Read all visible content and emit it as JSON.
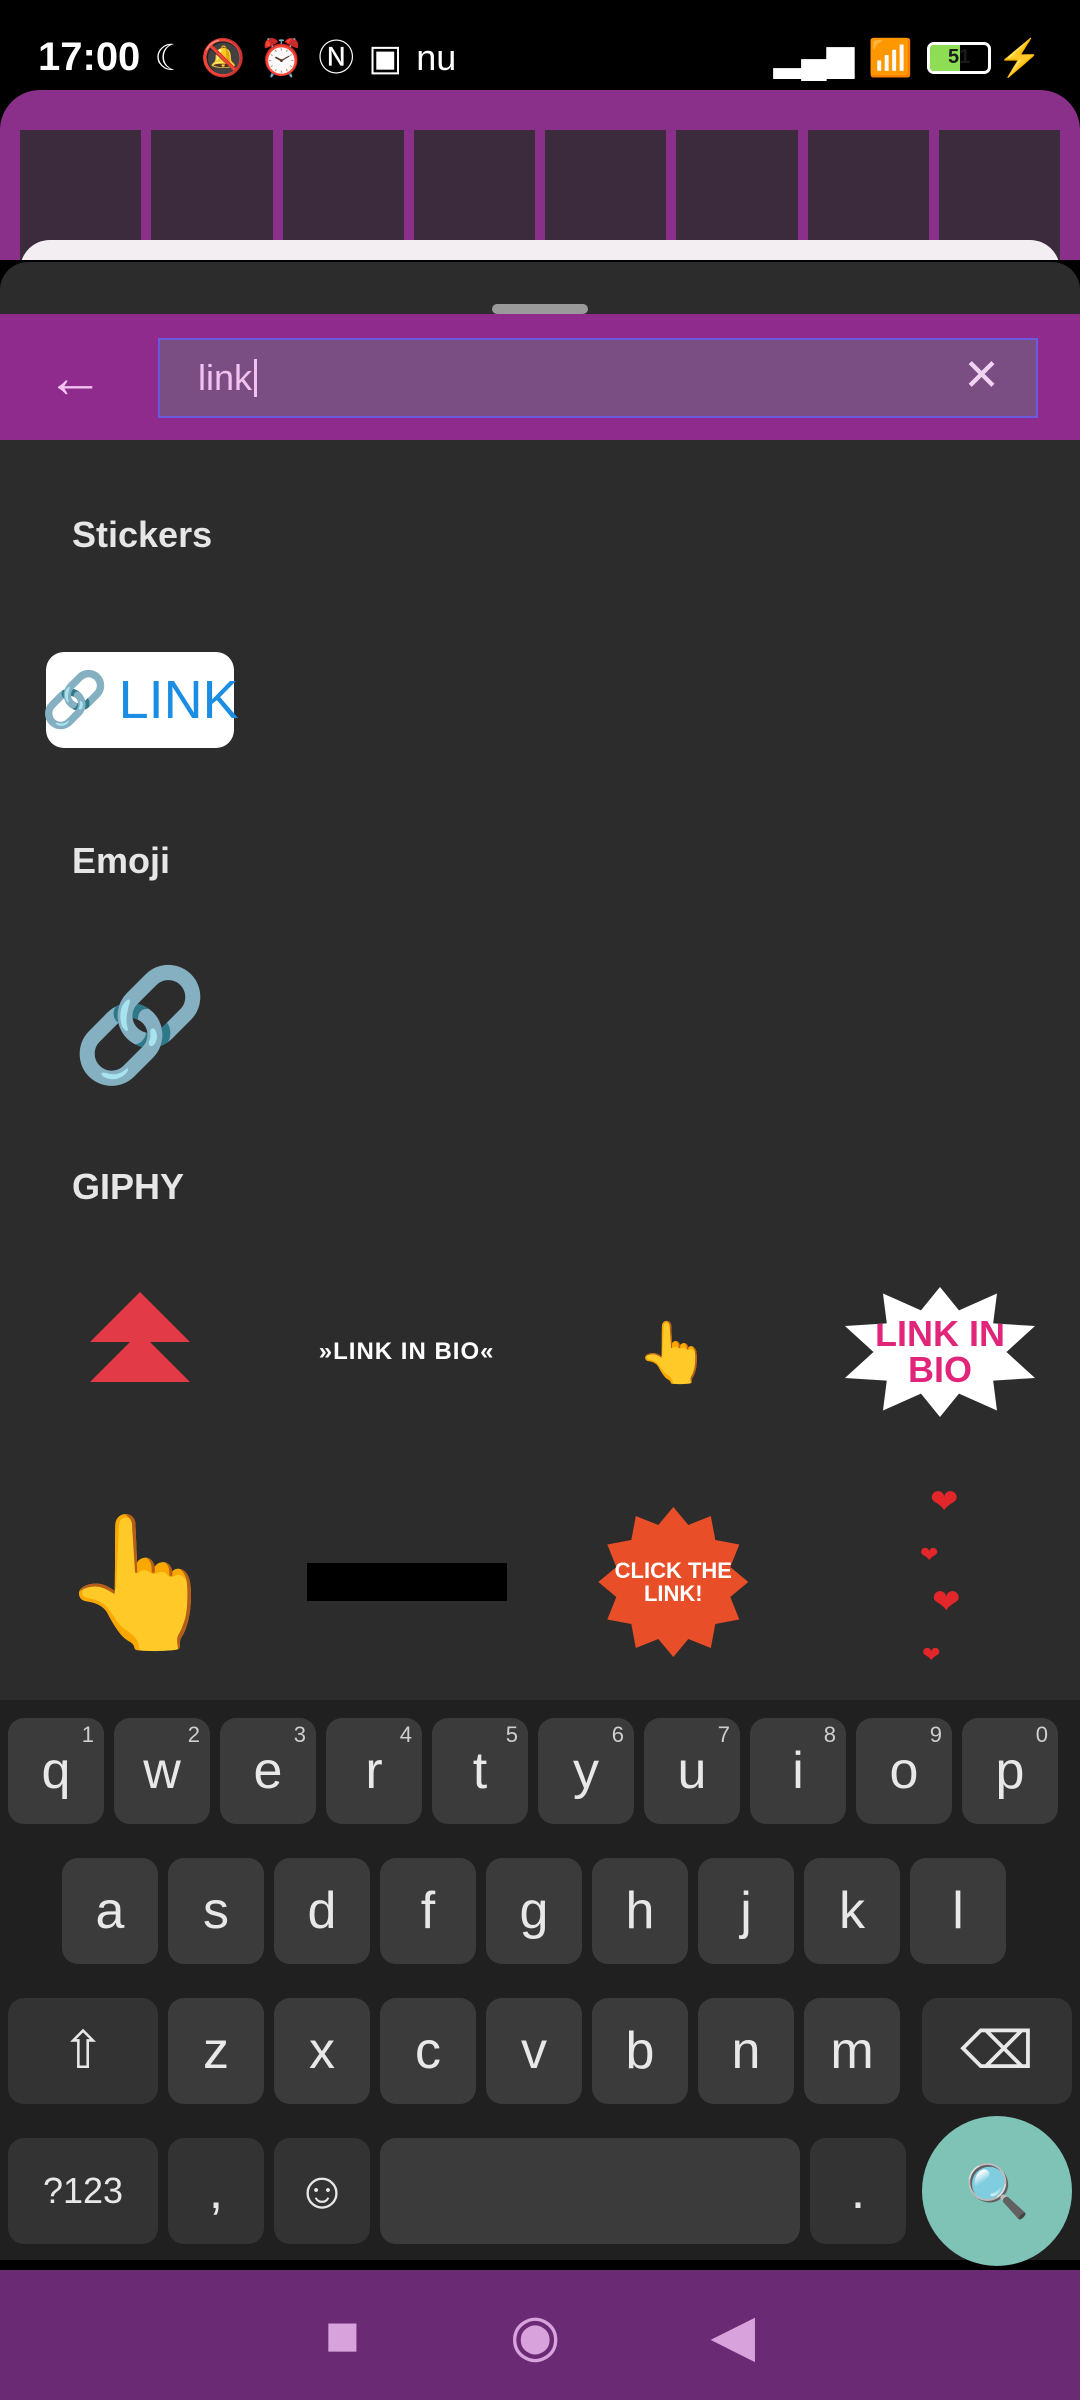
{
  "status_bar": {
    "time": "17:00",
    "icons_left": [
      "moon-icon",
      "bell-off-icon",
      "alarm-icon",
      "nfc-icon",
      "sim-icon",
      "nu-icon"
    ],
    "nu_text": "nu",
    "battery_level": "51"
  },
  "search": {
    "value": "link",
    "back_label": "←",
    "clear_label": "✕"
  },
  "sections": {
    "stickers": "Stickers",
    "emoji": "Emoji",
    "giphy": "GIPHY"
  },
  "stickers": {
    "first_label": "LINK"
  },
  "giphy": {
    "row1": {
      "link_in_bio_text": "»LINK IN BIO«",
      "starburst_text": "LINK IN BIO"
    },
    "row2": {
      "click_the_link_text": "CLICK THE LINK!"
    }
  },
  "keyboard": {
    "row1": [
      "q",
      "w",
      "e",
      "r",
      "t",
      "y",
      "u",
      "i",
      "o",
      "p"
    ],
    "row1_nums": [
      "1",
      "2",
      "3",
      "4",
      "5",
      "6",
      "7",
      "8",
      "9",
      "0"
    ],
    "row2": [
      "a",
      "s",
      "d",
      "f",
      "g",
      "h",
      "j",
      "k",
      "l"
    ],
    "row3": [
      "z",
      "x",
      "c",
      "v",
      "b",
      "n",
      "m"
    ],
    "symbols_label": "?123",
    "comma": ",",
    "period": ".",
    "shift_label": "⇧",
    "backspace_label": "⌫",
    "emoji_label": "☺",
    "search_label": "🔍"
  },
  "navbar": {
    "recents": "■",
    "home": "◉",
    "back": "◀"
  }
}
